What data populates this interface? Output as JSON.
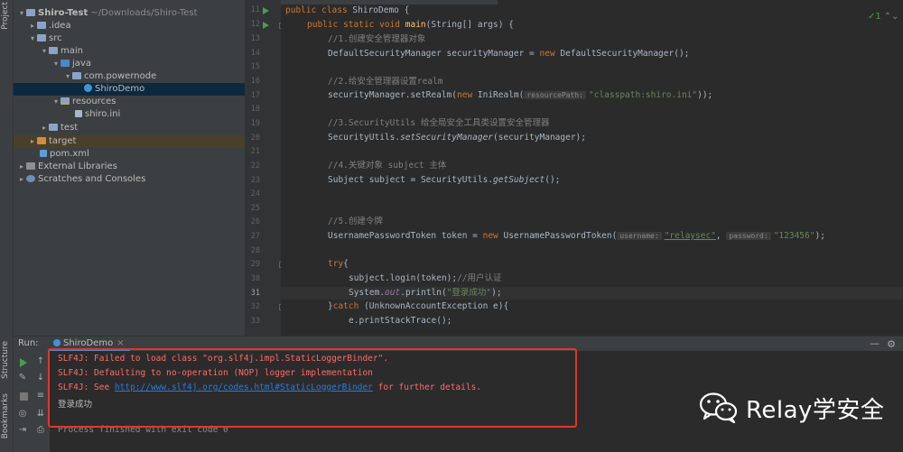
{
  "left_strip": {
    "project_label": "Project",
    "structure_label": "Structure",
    "bookmarks_label": "Bookmarks"
  },
  "project_tree": [
    {
      "label": "Shiro-Test",
      "suffix": "~/Downloads/Shiro-Test",
      "icon": "folder-icon",
      "arrow": "▾"
    },
    {
      "label": ".idea",
      "icon": "folder-icon",
      "arrow": "▸"
    },
    {
      "label": "src",
      "icon": "folder-icon",
      "arrow": "▾"
    },
    {
      "label": "main",
      "icon": "folder-icon",
      "arrow": "▾"
    },
    {
      "label": "java",
      "icon": "source-folder-icon",
      "arrow": "▾"
    },
    {
      "label": "com.powernode",
      "icon": "package-icon",
      "arrow": "▾"
    },
    {
      "label": "ShiroDemo",
      "icon": "java-class-icon",
      "arrow": ""
    },
    {
      "label": "resources",
      "icon": "resources-folder-icon",
      "arrow": "▾"
    },
    {
      "label": "shiro.ini",
      "icon": "ini-file-icon",
      "arrow": ""
    },
    {
      "label": "test",
      "icon": "folder-icon",
      "arrow": "▸"
    },
    {
      "label": "target",
      "icon": "excluded-folder-icon",
      "arrow": "▸"
    },
    {
      "label": "pom.xml",
      "icon": "maven-file-icon",
      "arrow": ""
    },
    {
      "label": "External Libraries",
      "icon": "library-icon",
      "arrow": "▸"
    },
    {
      "label": "Scratches and Consoles",
      "icon": "scratch-icon",
      "arrow": "▸"
    }
  ],
  "editor": {
    "inspection_count": "1",
    "lines": [
      {
        "num": "11",
        "text": "public class ShiroDemo {"
      },
      {
        "num": "12",
        "text": "    public static void main(String[] args) {"
      },
      {
        "num": "13",
        "text": "//1.创建安全管理器对象"
      },
      {
        "num": "14",
        "text": "DefaultSecurityManager securityManager = new DefaultSecurityManager();"
      },
      {
        "num": "15",
        "text": ""
      },
      {
        "num": "16",
        "text": "//2.给安全管理器设置realm"
      },
      {
        "num": "17",
        "text": "securityManager.setRealm(new IniRealm( resourcePath: \"classpath:shiro.ini\"));"
      },
      {
        "num": "18",
        "text": ""
      },
      {
        "num": "19",
        "text": "//3.SecurityUtils 给全局安全工具类设置安全管理器"
      },
      {
        "num": "20",
        "text": "SecurityUtils.setSecurityManager(securityManager);"
      },
      {
        "num": "21",
        "text": ""
      },
      {
        "num": "22",
        "text": "//4.关键对象 subject 主体"
      },
      {
        "num": "23",
        "text": "Subject subject = SecurityUtils.getSubject();"
      },
      {
        "num": "24",
        "text": ""
      },
      {
        "num": "25",
        "text": ""
      },
      {
        "num": "26",
        "text": "//5.创建令牌"
      },
      {
        "num": "27",
        "text": "UsernamePasswordToken token = new UsernamePasswordToken( username: \"relaysec\", password: \"123456\");"
      },
      {
        "num": "28",
        "text": ""
      },
      {
        "num": "29",
        "text": "try{"
      },
      {
        "num": "30",
        "text": "subject.login(token);//用户认证"
      },
      {
        "num": "31",
        "text": "System.out.println(\"登录成功\");"
      },
      {
        "num": "32",
        "text": "}catch (UnknownAccountException e){"
      },
      {
        "num": "33",
        "text": "e.printStackTrace();"
      }
    ],
    "tokens": {
      "public": "public",
      "class": "class",
      "static": "static",
      "void": "void",
      "new": "new",
      "try": "try",
      "catch": "catch",
      "class_name": "ShiroDemo",
      "main": "main",
      "main_args": "(String[] args) {",
      "brace_open": " {",
      "c1": "//1.创建安全管理器对象",
      "c2": "//2.给安全管理器设置realm",
      "c3": "//3.SecurityUtils 给全局安全工具类设置安全管理器",
      "c4": "//4.关键对象 subject 主体",
      "c5": "//5.创建令牌",
      "c6": "//用户认证",
      "l14a": "DefaultSecurityManager securityManager = ",
      "l14b": " DefaultSecurityManager();",
      "l17a": "securityManager.setRealm(",
      "l17b": " IniRealm(",
      "l17hint": "resourcePath:",
      "l17str": "\"classpath:shiro.ini\"",
      "l17c": "));",
      "l20a": "SecurityUtils.",
      "l20m": "setSecurityManager",
      "l20b": "(securityManager);",
      "l23a": "Subject subject = SecurityUtils.",
      "l23m": "getSubject",
      "l23b": "();",
      "l27a": "UsernamePasswordToken token = ",
      "l27b": " UsernamePasswordToken(",
      "l27hint1": "username:",
      "l27str1": "\"relaysec\"",
      "l27sep": ", ",
      "l27hint2": "password:",
      "l27str2": "\"123456\"",
      "l27c": ");",
      "l29b": "{",
      "l30a": "subject.login(token);",
      "l31a": "System.",
      "l31f": "out",
      "l31b": ".println(",
      "l31str": "\"登录成功\"",
      "l31c": ");",
      "l32a": "}",
      "l32b": " (UnknownAccountException e){",
      "l33a": "e.printStackTrace();"
    }
  },
  "run_panel": {
    "label": "Run:",
    "tab_label": "ShiroDemo",
    "tab_close": "×",
    "minimize": "—",
    "gear": "⚙",
    "console": {
      "err1": "SLF4J: Failed to load class \"org.slf4j.impl.StaticLoggerBinder\".",
      "err2": "SLF4J: Defaulting to no-operation (NOP) logger implementation",
      "err3_prefix": "SLF4J: See ",
      "err3_link": "http://www.slf4j.org/codes.html#StaticLoggerBinder",
      "err3_suffix": " for further details.",
      "out1": "登录成功",
      "out2": "Process finished with exit code 0"
    }
  },
  "watermark": {
    "text": "Relay学安全"
  },
  "colors": {
    "highlight_box": "#e5352b",
    "keyword": "#cc7832",
    "string": "#6a8759",
    "comment": "#808080",
    "error": "#ff6b68",
    "link": "#287bde"
  }
}
